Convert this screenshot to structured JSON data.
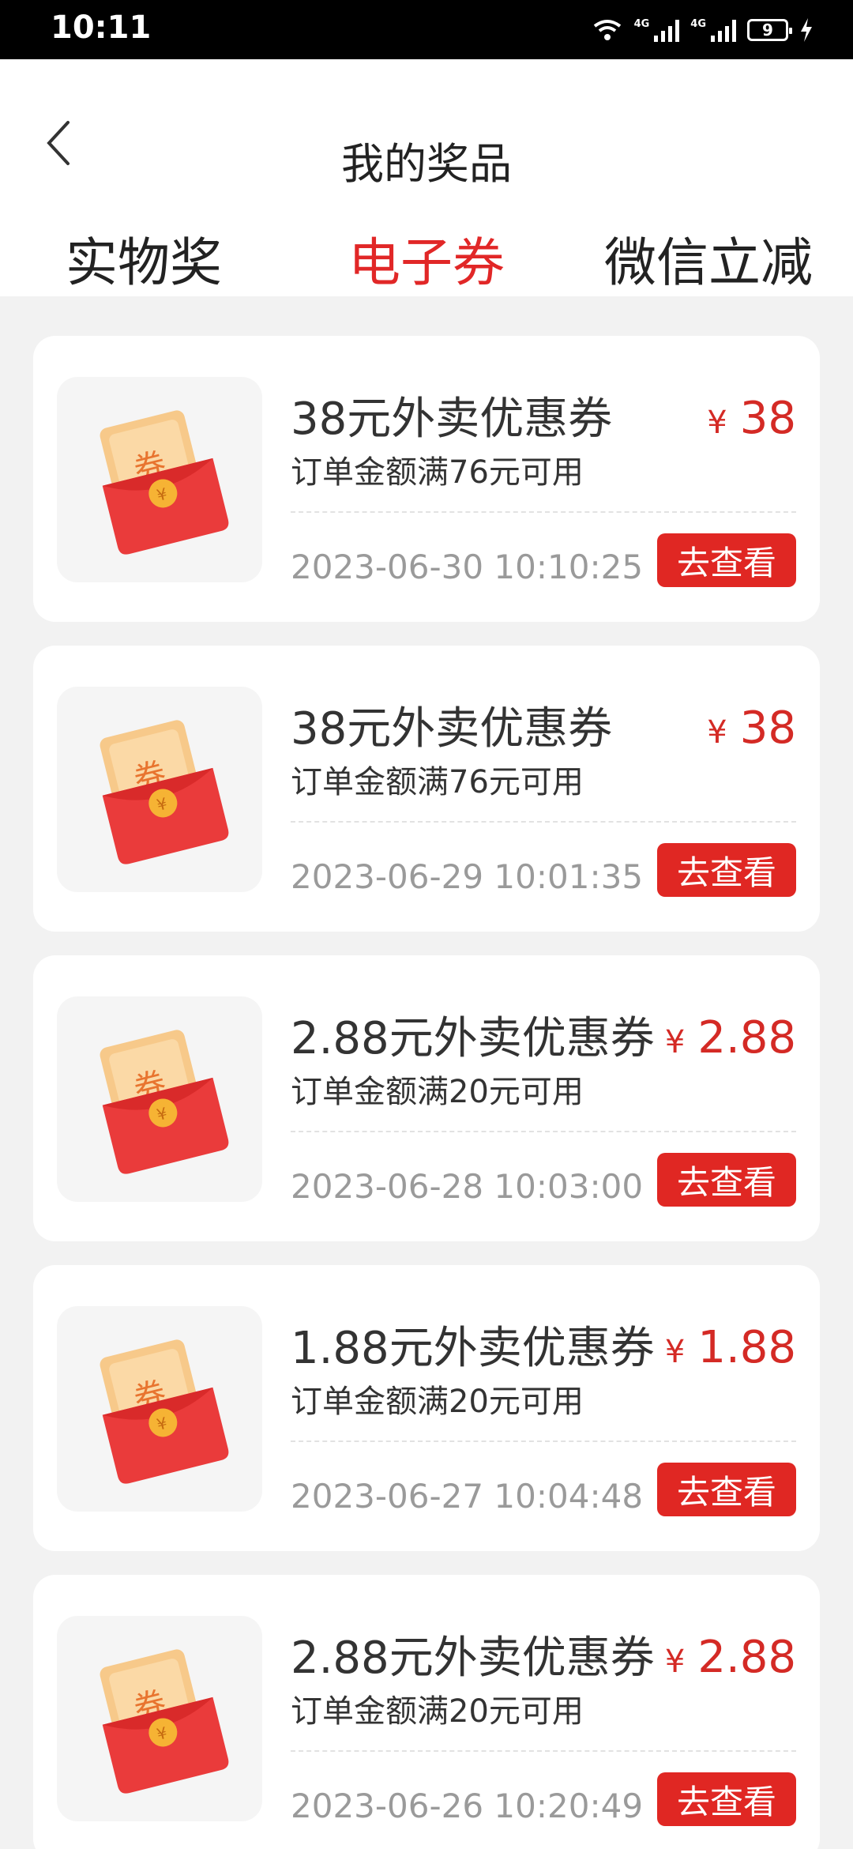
{
  "status_bar": {
    "time": "10:11",
    "net1": "4G",
    "net2": "4G",
    "battery": "9"
  },
  "header": {
    "title": "我的奖品"
  },
  "tabs": [
    {
      "label": "实物奖品",
      "active": false
    },
    {
      "label": "电子券",
      "active": true
    },
    {
      "label": "微信立减金",
      "active": false
    }
  ],
  "coupons": [
    {
      "title": "38元外卖优惠券",
      "condition": "订单金额满76元可用",
      "currency": "¥",
      "amount": "38",
      "date": "2023-06-30 10:10:25",
      "button": "去查看"
    },
    {
      "title": "38元外卖优惠券",
      "condition": "订单金额满76元可用",
      "currency": "¥",
      "amount": "38",
      "date": "2023-06-29 10:01:35",
      "button": "去查看"
    },
    {
      "title": "2.88元外卖优惠券",
      "condition": "订单金额满20元可用",
      "currency": "¥",
      "amount": "2.88",
      "date": "2023-06-28 10:03:00",
      "button": "去查看"
    },
    {
      "title": "1.88元外卖优惠券",
      "condition": "订单金额满20元可用",
      "currency": "¥",
      "amount": "1.88",
      "date": "2023-06-27 10:04:48",
      "button": "去查看"
    },
    {
      "title": "2.88元外卖优惠券",
      "condition": "订单金额满20元可用",
      "currency": "¥",
      "amount": "2.88",
      "date": "2023-06-26 10:20:49",
      "button": "去查看"
    }
  ],
  "icon_text": "券",
  "colors": {
    "accent": "#e12727",
    "price": "#d42a25",
    "button": "#e02723"
  }
}
